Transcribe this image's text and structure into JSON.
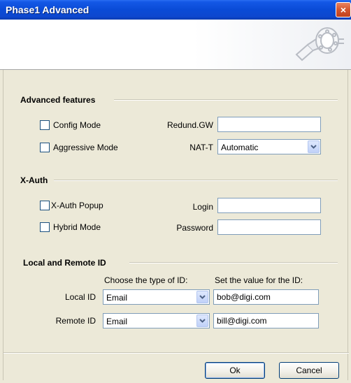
{
  "window": {
    "title": "Phase1 Advanced",
    "close_icon": "×"
  },
  "advanced": {
    "heading": "Advanced features",
    "config_mode": "Config Mode",
    "aggressive_mode": "Aggressive Mode",
    "redund_gw_label": "Redund.GW",
    "redund_gw_value": "",
    "nat_t_label": "NAT-T",
    "nat_t_value": "Automatic"
  },
  "xauth": {
    "heading": "X-Auth",
    "popup": "X-Auth Popup",
    "hybrid": "Hybrid Mode",
    "login_label": "Login",
    "login_value": "",
    "password_label": "Password",
    "password_value": ""
  },
  "ids": {
    "heading": "Local and Remote ID",
    "type_header": "Choose the type of ID:",
    "value_header": "Set the value for the ID:",
    "local_label": "Local ID",
    "local_type": "Email",
    "local_value": "bob@digi.com",
    "remote_label": "Remote ID",
    "remote_type": "Email",
    "remote_value": "bill@digi.com"
  },
  "buttons": {
    "ok": "Ok",
    "cancel": "Cancel"
  }
}
